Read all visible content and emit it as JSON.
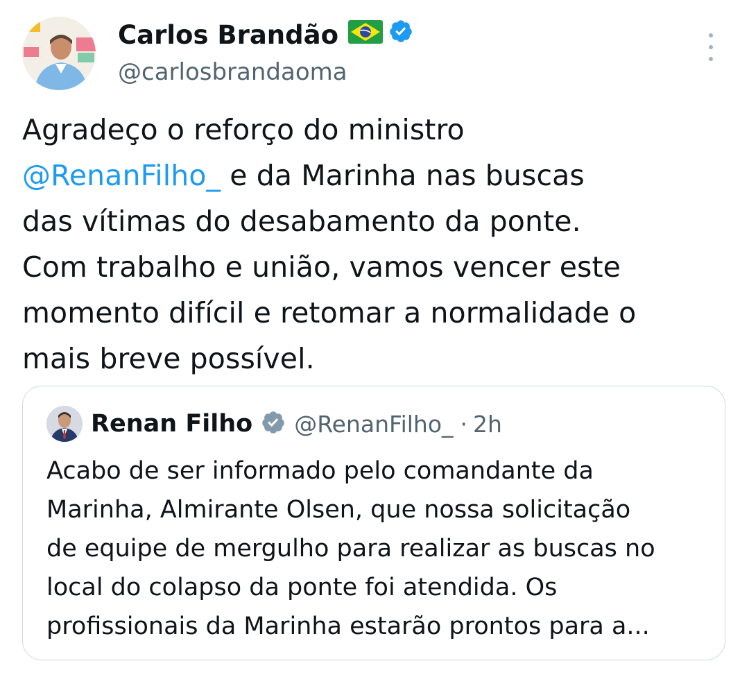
{
  "tweet": {
    "author_name": "Carlos Brandão",
    "author_handle": "@carlosbrandaoma",
    "flag_icon": "brazil-flag-icon",
    "badge_icon": "verified-badge-icon",
    "badge_color": "#1d9bf0",
    "more_icon": "more-options-icon",
    "text_lines": [
      {
        "before": "Agradeço o reforço do ministro",
        "mention": "",
        "after": ""
      },
      {
        "before": "",
        "mention": "@RenanFilho_",
        "after": "e da Marinha nas buscas"
      },
      {
        "before": "das vítimas do desabamento da ponte.",
        "mention": "",
        "after": ""
      },
      {
        "before": "Com trabalho e união, vamos vencer este",
        "mention": "",
        "after": ""
      },
      {
        "before": "momento difícil e retomar a normalidade o",
        "mention": "",
        "after": ""
      },
      {
        "before": "mais breve possível.",
        "mention": "",
        "after": ""
      }
    ]
  },
  "quoted_tweet": {
    "author_name": "Renan Filho",
    "author_handle": "@RenanFilho_",
    "separator": "·",
    "time": "2h",
    "badge_icon": "government-badge-icon",
    "badge_color": "#829aab",
    "text_lines": [
      "Acabo de ser informado pelo comandante da",
      "Marinha, Almirante Olsen, que nossa solicitação",
      "de equipe de mergulho para realizar as buscas no",
      "local do colapso da ponte foi atendida. Os",
      "profissionais da Marinha estarão prontos para a..."
    ]
  },
  "colors": {
    "text": "#0f1419",
    "secondary": "#536471",
    "mention": "#1d9bf0",
    "border": "#cfd9de"
  }
}
